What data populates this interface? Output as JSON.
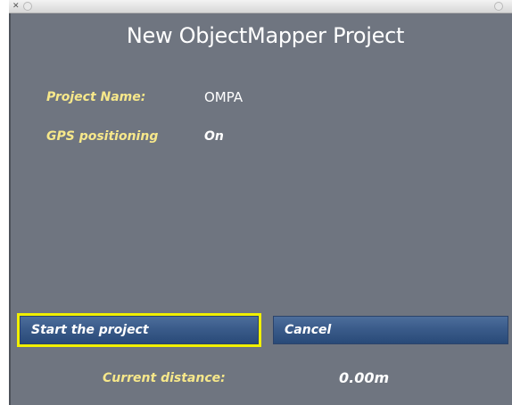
{
  "window": {
    "close_glyph": "✕"
  },
  "dialog": {
    "title": "New ObjectMapper Project",
    "fields": [
      {
        "label": "Project Name:",
        "value": "OMPA"
      },
      {
        "label": "GPS positioning",
        "value": "On"
      }
    ],
    "buttons": {
      "start": "Start the project",
      "cancel": "Cancel"
    },
    "distance": {
      "label": "Current distance:",
      "value": "0.00m"
    }
  },
  "colors": {
    "panel_bg": "#6f7580",
    "label_yellow": "#f7e88a",
    "button_blue": "#3a5b8a",
    "focus_outline": "#f1f000"
  }
}
